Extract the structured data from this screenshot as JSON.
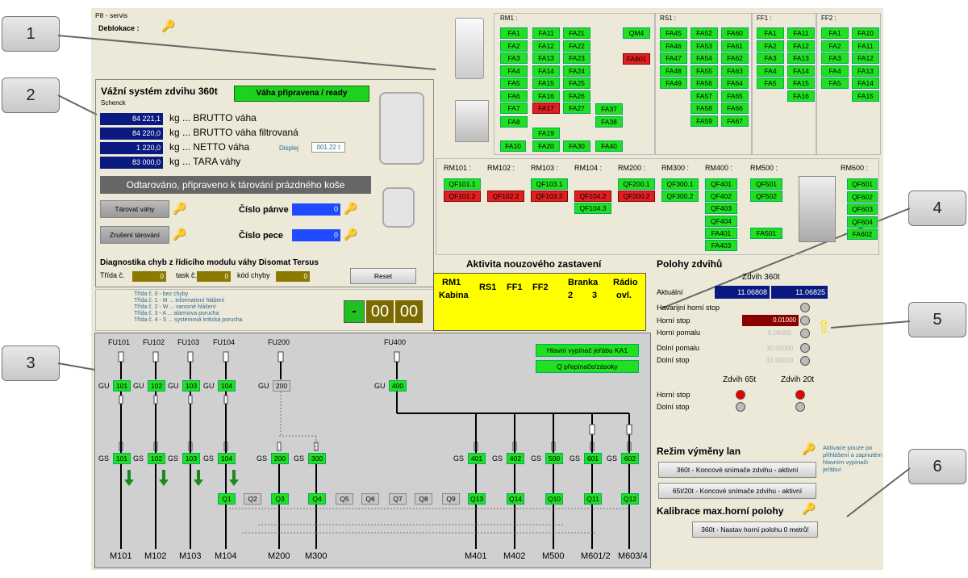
{
  "callouts": [
    "1",
    "2",
    "3",
    "4",
    "5",
    "6"
  ],
  "header": {
    "title": "P8 - servis",
    "deblokace": "Deblokace :"
  },
  "weigh": {
    "title": "Vážní systém zdvihu 360t",
    "brand": "Schenck",
    "ready": "Váha připravena / ready",
    "rows": [
      {
        "value": "84 221,1",
        "label": "kg ... BRUTTO váha"
      },
      {
        "value": "84 220,0",
        "label": "kg ... BRUTTO váha filtrovaná"
      },
      {
        "value": "1 220,0",
        "label": "kg ... NETTO váha"
      },
      {
        "value": "83 000,0",
        "label": "kg ... TARA váhy"
      }
    ],
    "displej_label": "Displej",
    "displej_value": "001.22 t",
    "status": "Odtarováno, připraveno k tárování prázdného koše",
    "tare_btn": "Tárovat váhy",
    "cancel_btn": "Zrušení tárování",
    "pan_label": "Číslo pánve",
    "pan_value": "0",
    "furnace_label": "Číslo pece",
    "furnace_value": "0",
    "diag_title": "Diagnostika chyb z řídicího modulu váhy Disomat Tersus",
    "trida": "Třída č.",
    "trida_v": "0",
    "task": "task č.",
    "task_v": "0",
    "kod": "kód chyby",
    "kod_v": "0",
    "reset": "Reset",
    "classes": [
      "Třída č. 0 - bez chyby",
      "Třída č. 1 - M ... informativní hlášení",
      "Třída č. 2 - W ... varovné hlášení",
      "Třída č. 3 - A ... alarmova porucha",
      "Třída č. 4 - S ... systémová kritická porucha"
    ],
    "clock": {
      "a": "-",
      "b": "00",
      "c": "00"
    }
  },
  "rm1": {
    "label": "RM1 :",
    "qm4": "QM4",
    "fa801": "FA801",
    "cols": [
      [
        "FA1",
        "FA2",
        "FA3",
        "FA4",
        "FA5",
        "FA6",
        "FA7",
        "FA8"
      ],
      [
        "FA11",
        "FA12",
        "FA13",
        "FA14",
        "FA15",
        "FA16",
        "FA17",
        "",
        "FA19",
        "FA20"
      ],
      [
        "FA21",
        "FA22",
        "FA23",
        "FA24",
        "FA25",
        "FA26",
        "FA27",
        "",
        "",
        "FA30"
      ],
      [
        "FA37",
        "FA38",
        "",
        "FA40"
      ]
    ],
    "fa10": "FA10"
  },
  "rs1": {
    "label": "RS1 :",
    "cols": [
      [
        "FA45",
        "FA46",
        "FA47",
        "FA48",
        "FA49"
      ],
      [
        "FA52",
        "FA53",
        "FA54",
        "FA55",
        "FA56",
        "FA57",
        "FA58",
        "FA59"
      ],
      [
        "FA60",
        "FA61",
        "FA62",
        "FA63",
        "FA64",
        "FA65",
        "FA66",
        "FA67"
      ]
    ]
  },
  "ff1": {
    "label": "FF1 :",
    "cols": [
      [
        "FA1",
        "FA2",
        "FA3",
        "FA4",
        "FA5"
      ],
      [
        "FA11",
        "FA12",
        "FA13",
        "FA14",
        "FA15",
        "FA16"
      ]
    ]
  },
  "ff2": {
    "label": "FF2 :",
    "cols": [
      [
        "FA1",
        "FA2",
        "FA3",
        "FA4",
        "FA5"
      ],
      [
        "FA10",
        "FA11",
        "FA12",
        "FA13",
        "FA14",
        "FA15"
      ]
    ]
  },
  "rm": {
    "labels": [
      "RM101 :",
      "RM102 :",
      "RM103 :",
      "RM104 :",
      "RM200 :",
      "RM300 :",
      "RM400 :",
      "RM500 :",
      "RM600 :"
    ],
    "rm101": [
      "QF101.1",
      "QF101.2"
    ],
    "rm102": "QF102.2",
    "rm103": [
      "QF103.1",
      "QF103.2"
    ],
    "rm104": [
      "QF104.2",
      "QF104.3"
    ],
    "rm200": [
      "QF200.1",
      "QF200.2"
    ],
    "rm300": [
      "QF300.1",
      "QF300.2"
    ],
    "rm400": [
      "QF401",
      "QF402",
      "QF403",
      "QF404",
      "FA401",
      "FA403"
    ],
    "rm500": [
      "QF501",
      "QF502",
      "FA501"
    ],
    "rm600": [
      "QF601",
      "QF602",
      "QF603",
      "QF604",
      "FA602"
    ]
  },
  "estop": {
    "title": "Aktivita nouzového zastavení",
    "cols": [
      "RM1 Kabina",
      "RS1",
      "FF1",
      "FF2",
      "Branka 2  3",
      "Rádio ovl."
    ],
    "c1a": "RM1",
    "c1b": "Kabina",
    "c5a": "Branka",
    "c5b": "2",
    "c5c": "3",
    "c6a": "Rádio",
    "c6b": "ovl."
  },
  "hoist": {
    "title": "Polohy zdvihů",
    "sub": "Zdvih 360t",
    "aktualni": "Aktuální",
    "v1": "11.06808",
    "v2": "11.06825",
    "rows": [
      "Havarijní horní stop",
      "Horní stop",
      "Horní pomalu",
      "Dolní pomalu",
      "Dolní stop"
    ],
    "vals": [
      "",
      "0.01000",
      "0.08000",
      "30.00000",
      "31.00000"
    ],
    "z65": "Zdvih 65t",
    "z20": "Zdvih 20t",
    "horni": "Horní stop",
    "dolni": "Dolní stop"
  },
  "rope": {
    "title": "Režim výměny lan",
    "note": "Aktivace pouze po přihlášení a zapnutém hlavním vypínači jeřábu!",
    "b1": "360t - Koncové snímače zdvihu - aktivní",
    "b2": "65t/20t - Koncové snímače zdvihu - aktivní",
    "cal": "Kalibrace max.horní polohy",
    "b3": "360t - Nastav horní polohu 0 metrů!"
  },
  "schema": {
    "fu": [
      "FU101",
      "FU102",
      "FU103",
      "FU104",
      "FU200",
      "FU400"
    ],
    "main_sw": "Hlavní vypínač jeřábu KA1",
    "preps": "Q přepínače/zásoky",
    "gu": [
      "101",
      "102",
      "103",
      "104",
      "200",
      "400"
    ],
    "gs": [
      "101",
      "102",
      "103",
      "104",
      "200",
      "300",
      "401",
      "402",
      "500",
      "601",
      "602"
    ],
    "q": [
      "Q1",
      "Q2",
      "Q3",
      "Q4",
      "Q5",
      "Q6",
      "Q7",
      "Q8",
      "Q9",
      "Q13",
      "Q14",
      "Q10",
      "Q11",
      "Q12"
    ],
    "m": [
      "M101",
      "M102",
      "M103",
      "M104",
      "M200",
      "M300",
      "M401",
      "M402",
      "M500",
      "M601/2",
      "M603/4"
    ],
    "GU": "GU",
    "GS": "GS"
  }
}
